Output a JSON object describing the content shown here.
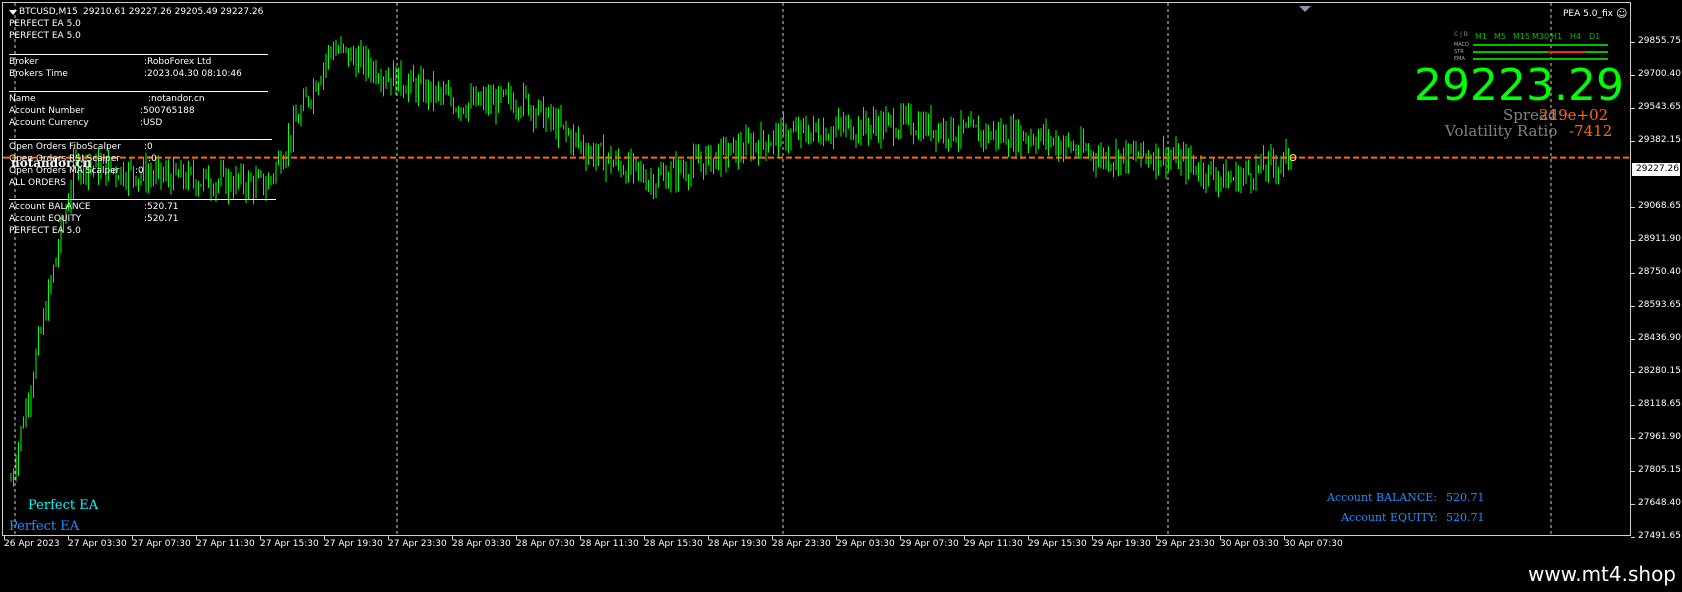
{
  "chart_header": {
    "symbol": "BTCUSD,M15",
    "ohlc": "29210.61 29227.26 29205.49 29227.26"
  },
  "ea_name": "PEA 5.0_fix",
  "info_panel": {
    "lines_top": [
      "PERFECT EA 5.0",
      "PERFECT EA 5.0"
    ],
    "broker_label": "Broker",
    "broker_value": ":RoboForex Ltd",
    "time_label": "Brokers Time",
    "time_value": ":2023.04.30 08:10:46",
    "name_label": "Name",
    "name_value": ":notandor.cn",
    "acct_label": "Account Number",
    "acct_value": ":500765188",
    "curr_label": "Account Currency",
    "curr_value": ":USD",
    "oo1_label": "Open Orders FiboScalper",
    "oo1_value": ":0",
    "oo2_label": "Open Orders RSI Scalper",
    "oo2_value": ":0",
    "oo3_label": "Open Orders MA Scalper",
    "oo3_value": ":0",
    "all_orders": "ALL ORDERS",
    "bal_label": "Account BALANCE",
    "bal_value": ":520.71",
    "eq_label": "Account EQUITY",
    "eq_value": ":520.71",
    "footer_line": "PERFECT EA 5.0",
    "overlay": "notandor.cn"
  },
  "bottom_left": {
    "line1": "Perfect EA",
    "line2": "Perfect EA"
  },
  "price_big": "29223.29",
  "spread_label": "Spread",
  "spread_value": "219e+02",
  "vol_label": "Volatility Ratio",
  "vol_value": "-7412",
  "account_box": {
    "balance_label": "Account BALANCE:",
    "balance_value": "520.71",
    "equity_label": "Account EQUITY:",
    "equity_value": "520.71"
  },
  "signal_table": {
    "timeframes": [
      "M1",
      "M5",
      "M15",
      "M30",
      "H1",
      "H4",
      "D1"
    ],
    "rows": [
      "MACD",
      "STR",
      "EMA"
    ],
    "corner": "C J B"
  },
  "current_price_label": "29227.26",
  "y_axis": [
    "29855.75",
    "29700.40",
    "29543.65",
    "29382.15",
    "29227.26",
    "29068.65",
    "28911.90",
    "28750.40",
    "28593.65",
    "28436.90",
    "28280.15",
    "28118.65",
    "27961.90",
    "27805.15",
    "27648.40",
    "27491.65"
  ],
  "x_axis": [
    "26 Apr 2023",
    "27 Apr 03:30",
    "27 Apr 07:30",
    "27 Apr 11:30",
    "27 Apr 15:30",
    "27 Apr 19:30",
    "27 Apr 23:30",
    "28 Apr 03:30",
    "28 Apr 07:30",
    "28 Apr 11:30",
    "28 Apr 15:30",
    "28 Apr 19:30",
    "28 Apr 23:30",
    "29 Apr 03:30",
    "29 Apr 07:30",
    "29 Apr 11:30",
    "29 Apr 15:30",
    "29 Apr 19:30",
    "29 Apr 23:30",
    "30 Apr 03:30",
    "30 Apr 07:30"
  ],
  "footer_url": "www.mt4.shop",
  "colors": {
    "candle": "#00ff00",
    "price_line": "#ff6a00",
    "big_price": "#00ff00",
    "spread_value": "#ff6a00",
    "account_text": "#1e90ff",
    "perfect_ea": "#00ffff"
  },
  "chart_data": {
    "type": "line",
    "title": "BTCUSD,M15",
    "x": [
      "26 Apr 2023",
      "27 Apr 03:30",
      "27 Apr 07:30",
      "27 Apr 11:30",
      "27 Apr 15:30",
      "27 Apr 19:30",
      "27 Apr 23:30",
      "28 Apr 03:30",
      "28 Apr 07:30",
      "28 Apr 11:30",
      "28 Apr 15:30",
      "28 Apr 19:30",
      "28 Apr 23:30",
      "29 Apr 03:30",
      "29 Apr 07:30",
      "29 Apr 11:30",
      "29 Apr 15:30",
      "29 Apr 19:30",
      "29 Apr 23:30",
      "30 Apr 03:30",
      "30 Apr 07:30"
    ],
    "series": [
      {
        "name": "BTCUSD,M15",
        "values": [
          27700,
          29200,
          29150,
          29120,
          29100,
          29750,
          29600,
          29480,
          29500,
          29260,
          29120,
          29230,
          29330,
          29370,
          29390,
          29340,
          29330,
          29230,
          29240,
          29120,
          29227
        ]
      }
    ],
    "ylim": [
      27430,
      29960
    ]
  }
}
